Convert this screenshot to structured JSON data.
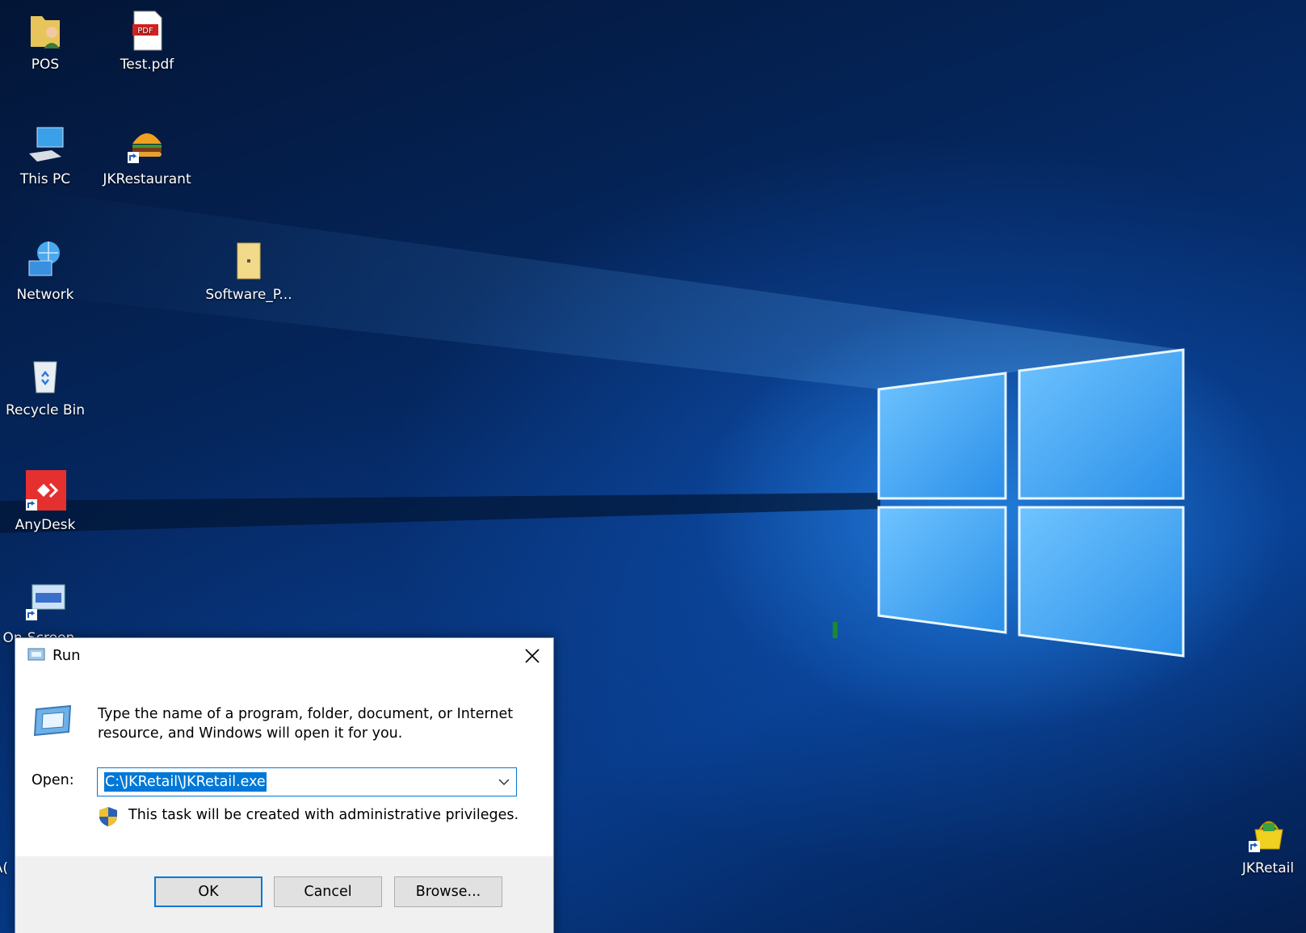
{
  "desktop": {
    "icons": [
      {
        "label": "POS",
        "icon": "user-folder-icon"
      },
      {
        "label": "Test.pdf",
        "icon": "pdf-file-icon"
      },
      {
        "label": "This PC",
        "icon": "computer-icon"
      },
      {
        "label": "JKRestaurant",
        "icon": "burger-shortcut-icon"
      },
      {
        "label": "Network",
        "icon": "network-globe-icon"
      },
      {
        "label": "Software_P...",
        "icon": "folder-zip-icon"
      },
      {
        "label": "Recycle Bin",
        "icon": "recycle-bin-icon"
      },
      {
        "label": "AnyDesk",
        "icon": "anydesk-shortcut-icon"
      },
      {
        "label": "On-Screen...",
        "icon": "keyboard-shortcut-icon"
      },
      {
        "label": "JKRetail",
        "icon": "shopping-basket-shortcut-icon"
      }
    ],
    "partial_left_label": "A("
  },
  "run_dialog": {
    "title": "Run",
    "description": "Type the name of a program, folder, document, or Internet resource, and Windows will open it for you.",
    "open_label": "Open:",
    "open_value": "C:\\JKRetail\\JKRetail.exe",
    "admin_note": "This task will be created with administrative privileges.",
    "buttons": {
      "ok": "OK",
      "cancel": "Cancel",
      "browse": "Browse..."
    }
  },
  "colors": {
    "accent": "#0078d7",
    "dialog_footer": "#f0f0f0"
  }
}
